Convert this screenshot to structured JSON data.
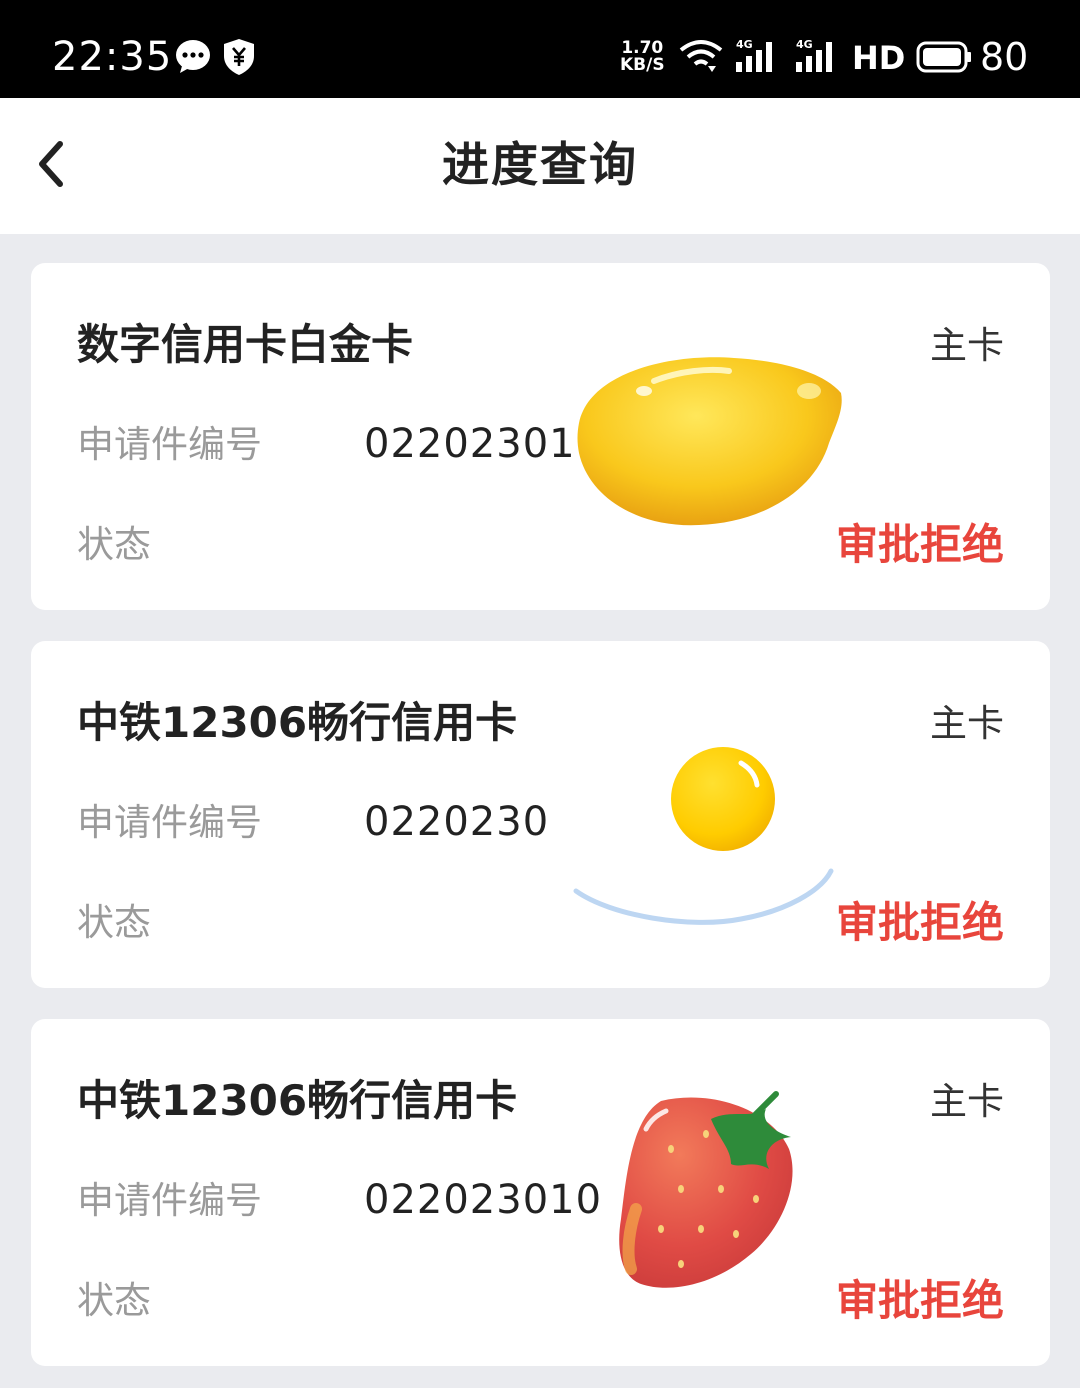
{
  "status_bar": {
    "time": "22:35",
    "speed_value": "1.70",
    "speed_unit": "KB/S",
    "network_hd": "HD",
    "battery": "80"
  },
  "header": {
    "title": "进度查询"
  },
  "cards": [
    {
      "title": "数字信用卡白金卡",
      "type": "主卡",
      "app_label": "申请件编号",
      "app_number": "02202301",
      "status_label": "状态",
      "status_value": "审批拒绝",
      "sticker": "lemon-sticker"
    },
    {
      "title": "中铁12306畅行信用卡",
      "type": "主卡",
      "app_label": "申请件编号",
      "app_number": "0220230",
      "status_label": "状态",
      "status_value": "审批拒绝",
      "sticker": "fried-egg-sticker"
    },
    {
      "title": "中铁12306畅行信用卡",
      "type": "主卡",
      "app_label": "申请件编号",
      "app_number": "022023010",
      "status_label": "状态",
      "status_value": "审批拒绝",
      "sticker": "strawberry-sticker"
    }
  ],
  "colors": {
    "status_reject": "#e8453c",
    "page_bg": "#eaebef"
  }
}
